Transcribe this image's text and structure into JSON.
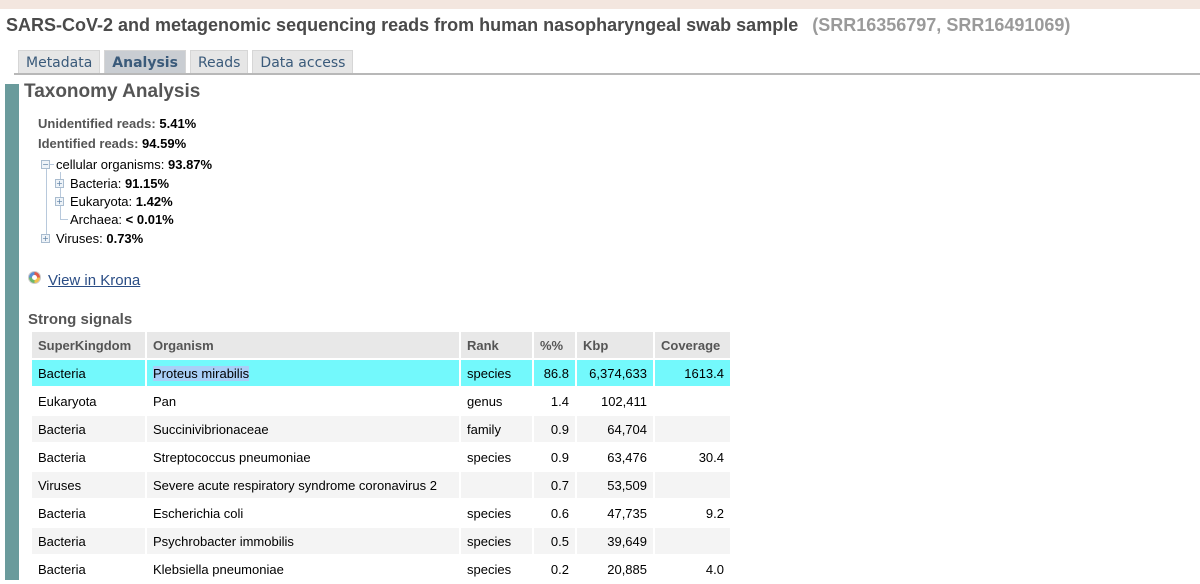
{
  "header": {
    "title": "SARS-CoV-2 and metagenomic sequencing reads from human nasopharyngeal swab sample",
    "accession_open": "(",
    "accession_1": "SRR16356797",
    "accession_sep": ", ",
    "accession_2": "SRR16491069",
    "accession_close": ")"
  },
  "tabs": [
    {
      "label": "Metadata"
    },
    {
      "label": "Analysis"
    },
    {
      "label": "Reads"
    },
    {
      "label": "Data access"
    }
  ],
  "taxonomy": {
    "heading": "Taxonomy Analysis",
    "unidentified_label": "Unidentified reads:",
    "unidentified_value": "5.41%",
    "identified_label": "Identified reads:",
    "identified_value": "94.59%",
    "tree": {
      "cellular_label": "cellular organisms:",
      "cellular_value": "93.87%",
      "bacteria_label": "Bacteria:",
      "bacteria_value": "91.15%",
      "eukaryota_label": "Eukaryota:",
      "eukaryota_value": "1.42%",
      "archaea_label": "Archaea:",
      "archaea_value": "< 0.01%",
      "viruses_label": "Viruses:",
      "viruses_value": "0.73%"
    },
    "krona_link": "View in Krona"
  },
  "strong_signals": {
    "heading": "Strong signals",
    "columns": [
      "SuperKingdom",
      "Organism",
      "Rank",
      "%%",
      "Kbp",
      "Coverage"
    ],
    "rows": [
      {
        "superkingdom": "Bacteria",
        "organism": "Proteus mirabilis",
        "rank": "species",
        "pct": "86.8",
        "kbp": "6,374,633",
        "coverage": "1613.4"
      },
      {
        "superkingdom": "Eukaryota",
        "organism": "Pan",
        "rank": "genus",
        "pct": "1.4",
        "kbp": "102,411",
        "coverage": ""
      },
      {
        "superkingdom": "Bacteria",
        "organism": "Succinivibrionaceae",
        "rank": "family",
        "pct": "0.9",
        "kbp": "64,704",
        "coverage": ""
      },
      {
        "superkingdom": "Bacteria",
        "organism": "Streptococcus pneumoniae",
        "rank": "species",
        "pct": "0.9",
        "kbp": "63,476",
        "coverage": "30.4"
      },
      {
        "superkingdom": "Viruses",
        "organism": "Severe acute respiratory syndrome coronavirus 2",
        "rank": "",
        "pct": "0.7",
        "kbp": "53,509",
        "coverage": ""
      },
      {
        "superkingdom": "Bacteria",
        "organism": "Escherichia coli",
        "rank": "species",
        "pct": "0.6",
        "kbp": "47,735",
        "coverage": "9.2"
      },
      {
        "superkingdom": "Bacteria",
        "organism": "Psychrobacter immobilis",
        "rank": "species",
        "pct": "0.5",
        "kbp": "39,649",
        "coverage": ""
      },
      {
        "superkingdom": "Bacteria",
        "organism": "Klebsiella pneumoniae",
        "rank": "species",
        "pct": "0.2",
        "kbp": "20,885",
        "coverage": "4.0"
      }
    ]
  },
  "colors": {
    "selected_row": "#73f9fc",
    "sidebar": "#6a9b9c",
    "link": "#2a4d85"
  }
}
